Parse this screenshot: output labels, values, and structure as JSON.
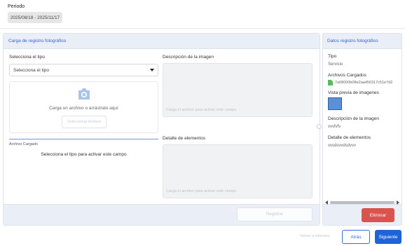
{
  "periodo": {
    "label": "Periodo",
    "range": "2025/08/18 - 2025/11/17"
  },
  "carga": {
    "title": "Carga de registro fotográfico",
    "tipo_label": "Selecciona el tipo",
    "tipo_placeholder": "Selecciona el tipo",
    "upload_text": "Carga un archivo o arrástralo aquí",
    "upload_button": "Seleccionar Archivo",
    "archivo_cargado_label": "Archivo Cargado",
    "tipo_notice": "Selecciona el tipo para activar este campo",
    "descripcion_label": "Descripción de la imagen",
    "descripcion_placeholder": "Carga el archivo para activar este campo",
    "detalle_label": "Detalle de elementos",
    "detalle_placeholder": "Carga el archivo para activar este campo",
    "registrar_button": "Registrar"
  },
  "datos": {
    "title": "Datos registro fotográfico",
    "tipo_label": "Tipo",
    "tipo_value": "Servicio",
    "archivos_label": "Archivos Cargados",
    "archivo_name": "7a08000b08e2aa456317c51e7d2",
    "vista_label": "Vista previa de imagenes",
    "descripcion_label": "Descripción de la imagen",
    "descripcion_value": "vvvfvfv",
    "detalle_label": "Detalle de elementos",
    "detalle_value": "vvsdsvvdsdvvv",
    "eliminar_button": "Eliminar"
  },
  "footer": {
    "volver_label": "Volver a informes",
    "atras_button": "Atrás",
    "siguiente_button": "Siguiente"
  },
  "colors": {
    "accent": "#1f63d8",
    "header_title": "#3a63c4",
    "danger": "#d9534f",
    "preview_thumb": "#5b8fd6"
  },
  "icons": {
    "camera": "camera-icon",
    "dropdown": "chevron-down-icon",
    "file": "file-icon"
  }
}
